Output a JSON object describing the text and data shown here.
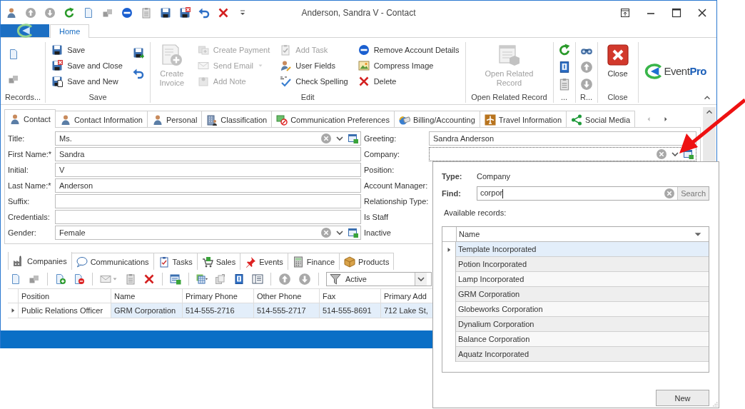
{
  "window": {
    "title": "Anderson, Sandra V - Contact"
  },
  "ribbon": {
    "tabs": [
      {
        "label": "Home",
        "selected": true
      }
    ],
    "groups": [
      {
        "kind": "icons",
        "label": "Records..."
      },
      {
        "kind": "list",
        "label": "Save",
        "buttons": [
          {
            "label": "Save"
          },
          {
            "label": "Save and Close"
          },
          {
            "label": "Save and New"
          }
        ]
      },
      {
        "kind": "edit",
        "label": "Edit",
        "large": {
          "label": "Create Invoice",
          "disabled": true
        },
        "columns": [
          [
            {
              "label": "Create Payment",
              "disabled": true,
              "dropdown": false
            },
            {
              "label": "Send Email",
              "disabled": true,
              "dropdown": true
            },
            {
              "label": "Add Note",
              "disabled": true,
              "dropdown": false
            }
          ],
          [
            {
              "label": "Add Task",
              "disabled": true,
              "dropdown": false
            },
            {
              "label": "User Fields",
              "disabled": false,
              "dropdown": false
            },
            {
              "label": "Check Spelling",
              "disabled": false,
              "dropdown": false
            }
          ],
          [
            {
              "label": "Remove Account Details",
              "disabled": false,
              "dropdown": false
            },
            {
              "label": "Compress Image",
              "disabled": false,
              "dropdown": false
            },
            {
              "label": "Delete",
              "disabled": false,
              "dropdown": false
            }
          ]
        ]
      },
      {
        "kind": "large",
        "label": "Open Related Record",
        "large": {
          "label": "Open Related Record",
          "disabled": true
        }
      },
      {
        "kind": "icons",
        "label": "..."
      },
      {
        "kind": "icons",
        "label": "R..."
      },
      {
        "kind": "large",
        "label": "Close",
        "large": {
          "label": "Close",
          "disabled": false
        }
      }
    ],
    "logo": "Event**Pro**"
  },
  "contact_tabs": [
    {
      "label": "Contact",
      "selected": true
    },
    {
      "label": "Contact Information",
      "selected": false
    },
    {
      "label": "Personal",
      "selected": false
    },
    {
      "label": "Classification",
      "selected": false
    },
    {
      "label": "Communication Preferences",
      "selected": false
    },
    {
      "label": "Billing/Accounting",
      "selected": false
    },
    {
      "label": "Travel Information",
      "selected": false
    },
    {
      "label": "Social Media",
      "selected": false
    }
  ],
  "form": {
    "left": [
      {
        "label": "Title:",
        "kind": "lookup",
        "value": "Ms."
      },
      {
        "label": "First Name:*",
        "kind": "text",
        "value": "Sandra"
      },
      {
        "label": "Initial:",
        "kind": "text",
        "value": "V"
      },
      {
        "label": "Last Name:*",
        "kind": "text",
        "value": "Anderson"
      },
      {
        "label": "Suffix:",
        "kind": "text"
      },
      {
        "label": "Credentials:",
        "kind": "text"
      },
      {
        "label": "Gender:",
        "kind": "lookup",
        "value": "Female"
      }
    ],
    "right": [
      {
        "label": "Greeting:",
        "kind": "text",
        "value": "Sandra Anderson",
        "focused": false
      },
      {
        "label": "Company:",
        "kind": "lookup",
        "focused": true
      },
      {
        "label": "Position:"
      },
      {
        "label": "Account Manager:"
      },
      {
        "label": "Relationship Type:"
      },
      {
        "label": "Is Staff"
      },
      {
        "label": "Inactive"
      }
    ]
  },
  "related_tabs": [
    {
      "label": "Companies",
      "selected": true
    },
    {
      "label": "Communications",
      "selected": false
    },
    {
      "label": "Tasks",
      "selected": false
    },
    {
      "label": "Sales",
      "selected": false
    },
    {
      "label": "Events",
      "selected": false
    },
    {
      "label": "Finance",
      "selected": false
    },
    {
      "label": "Products",
      "selected": false
    }
  ],
  "related_toolbar": {
    "filter": "Active"
  },
  "grid": {
    "columns": [
      "Position",
      "Name",
      "Primary Phone",
      "Other Phone",
      "Fax",
      "Primary Add"
    ],
    "rows": [
      {
        "selected": true,
        "cells": [
          {
            "text": "Public Relations Officer",
            "focused": true
          },
          {
            "text": "GRM Corporation",
            "focused": false
          },
          {
            "text": "514-555-2716",
            "focused": false
          },
          {
            "text": "514-555-2717",
            "focused": false
          },
          {
            "text": "514-555-8691",
            "focused": false
          },
          {
            "text": "712 Lake St,",
            "focused": false
          }
        ]
      }
    ]
  },
  "lookup_popup": {
    "type_label": "Type:",
    "type_value": "Company",
    "find_label": "Find:",
    "find_value": "corpor",
    "search_button": "Search",
    "available_label": "Available records:",
    "columns": [
      "Name"
    ],
    "records": [
      {
        "name": "Template Incorporated",
        "selected": true
      },
      {
        "name": "Potion Incorporated",
        "selected": false
      },
      {
        "name": "Lamp Incorporated",
        "selected": false
      },
      {
        "name": "GRM Corporation",
        "selected": false
      },
      {
        "name": "Globeworks Corporation",
        "selected": false
      },
      {
        "name": "Dynalium Corporation",
        "selected": false
      },
      {
        "name": "Balance Corporation",
        "selected": false
      },
      {
        "name": "Aquatz Incorporated",
        "selected": false
      }
    ],
    "new_button": "New"
  }
}
